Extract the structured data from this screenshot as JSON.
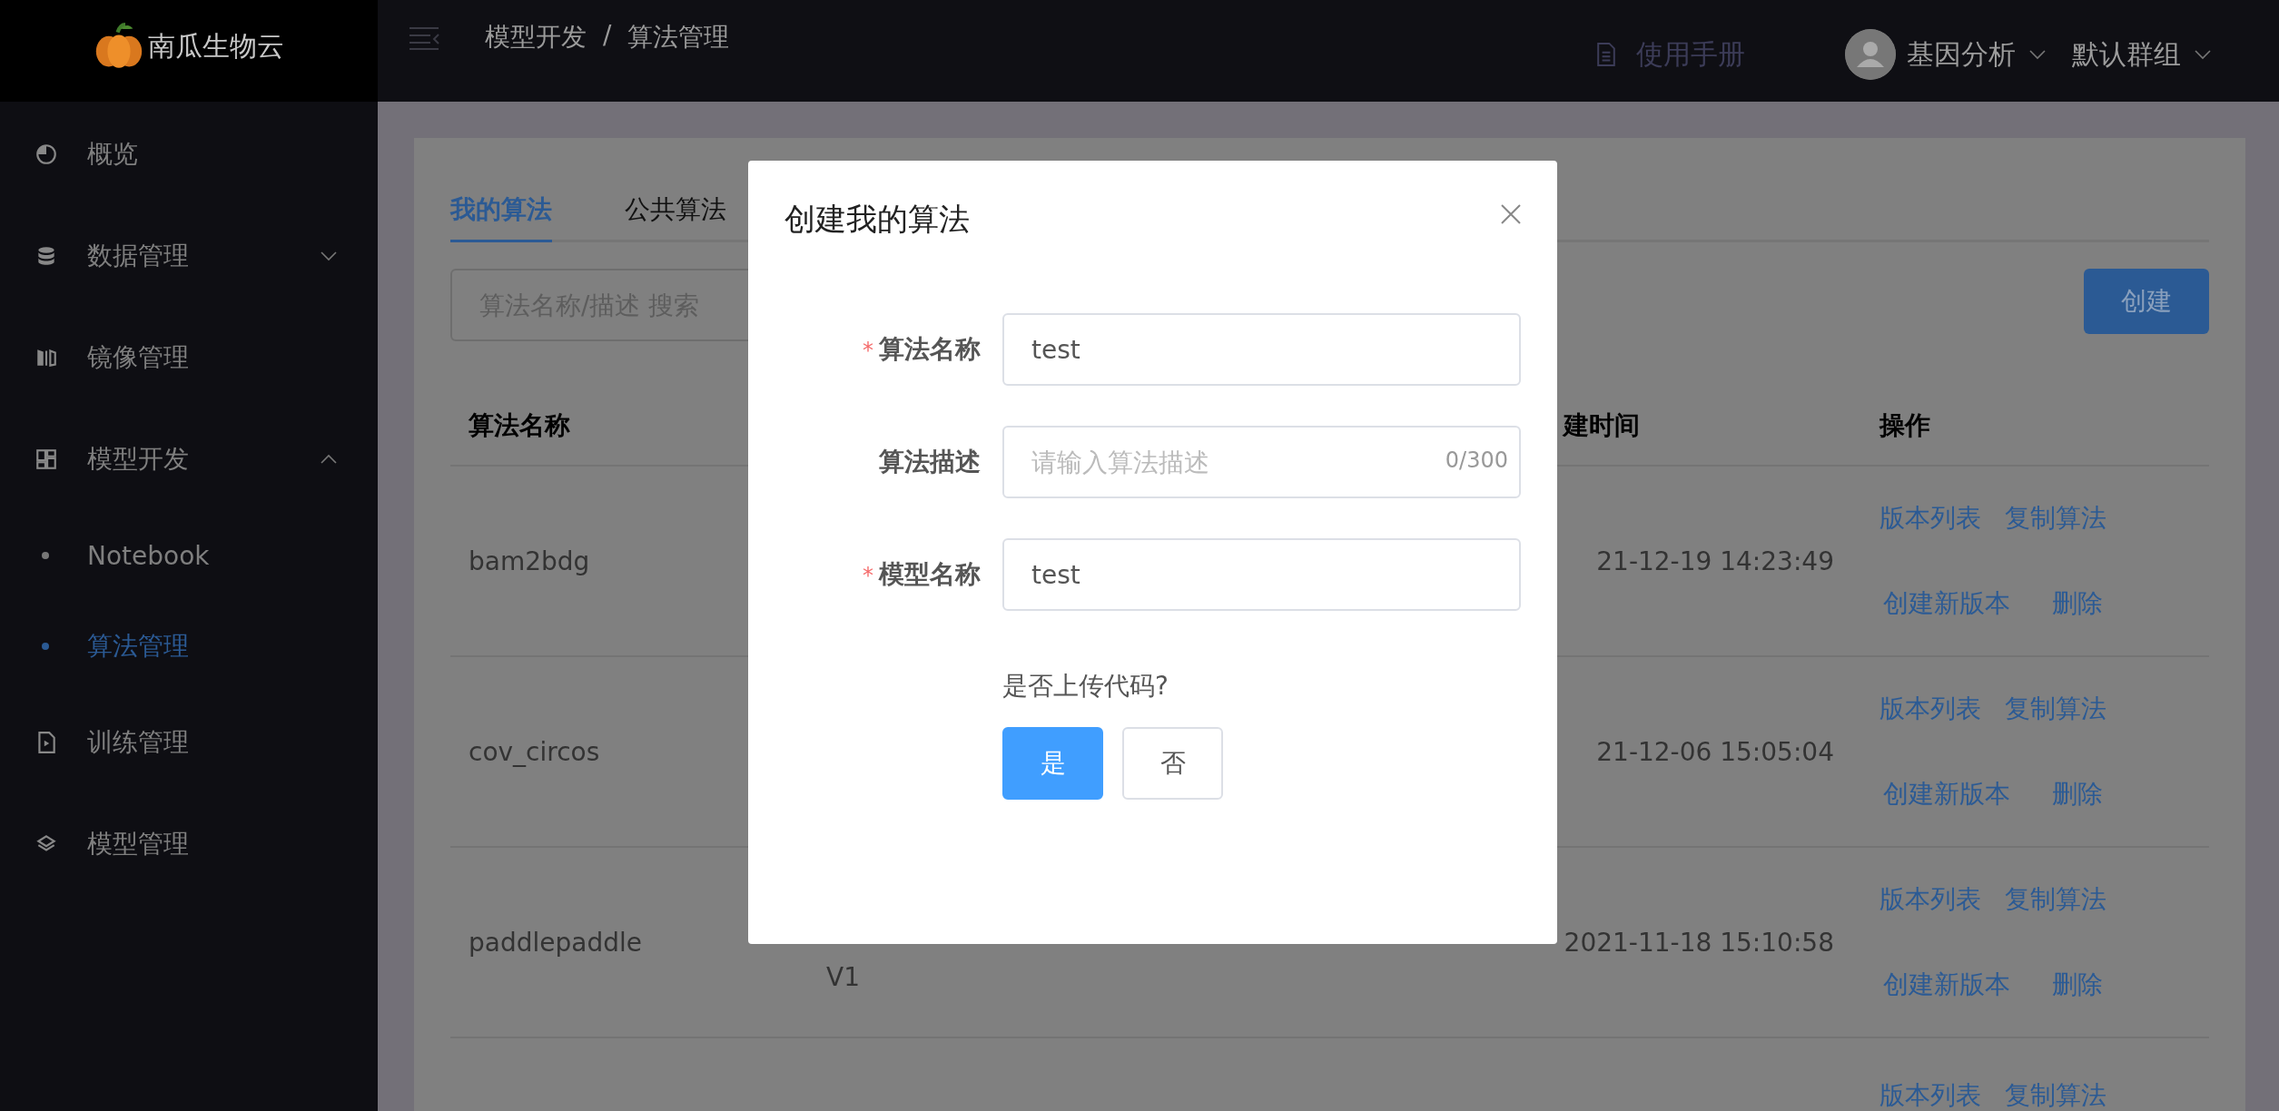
{
  "header": {
    "logo": "南瓜生物云",
    "breadcrumb": [
      "模型开发",
      "/",
      "算法管理"
    ],
    "manual": "使用手册",
    "user": "基因分析",
    "group": "默认群组"
  },
  "sidebar": {
    "items": [
      {
        "label": "概览",
        "selected": false
      },
      {
        "label": "数据管理",
        "selected": false,
        "expanded": false
      },
      {
        "label": "镜像管理",
        "selected": false
      },
      {
        "label": "模型开发",
        "selected": false,
        "expanded": true,
        "children": [
          {
            "label": "Notebook",
            "selected": false
          },
          {
            "label": "算法管理",
            "selected": true
          }
        ]
      },
      {
        "label": "训练管理",
        "selected": false
      },
      {
        "label": "模型管理",
        "selected": false
      }
    ]
  },
  "tabs": [
    {
      "label": "我的算法",
      "selected": true
    },
    {
      "label": "公共算法",
      "selected": false
    }
  ],
  "search": {
    "placeholder": "算法名称/描述 搜索"
  },
  "create_button": "创建",
  "table": {
    "columns": {
      "name": "算法名称",
      "column_3": "建时间",
      "actions": "操作"
    },
    "rows": [
      {
        "name": "bam2bdg",
        "created": "21-12-19 14:23:49",
        "actions": [
          "版本列表",
          "复制算法",
          "创建新版本",
          "删除"
        ]
      },
      {
        "name": "cov_circos",
        "created": "21-12-06 15:05:04",
        "actions": [
          "版本列表",
          "复制算法",
          "创建新版本",
          "删除"
        ]
      },
      {
        "name": "paddlepaddle",
        "version": "V1",
        "created": "2021-11-18 15:10:58",
        "actions": [
          "版本列表",
          "复制算法",
          "创建新版本",
          "删除"
        ]
      },
      {
        "actions": [
          "版本列表",
          "复制算法"
        ]
      }
    ]
  },
  "modal": {
    "title": "创建我的算法",
    "fields": [
      {
        "label": "算法名称",
        "required_mark": "*",
        "value": "test"
      },
      {
        "label": "算法描述",
        "placeholder": "请输入算法描述",
        "counter": "0/300"
      },
      {
        "label": "模型名称",
        "required_mark": "*",
        "value": "test"
      }
    ],
    "question": "是否上传代码?",
    "choices": [
      {
        "label": "是",
        "selected": true
      },
      {
        "label": "否",
        "selected": false
      }
    ]
  }
}
